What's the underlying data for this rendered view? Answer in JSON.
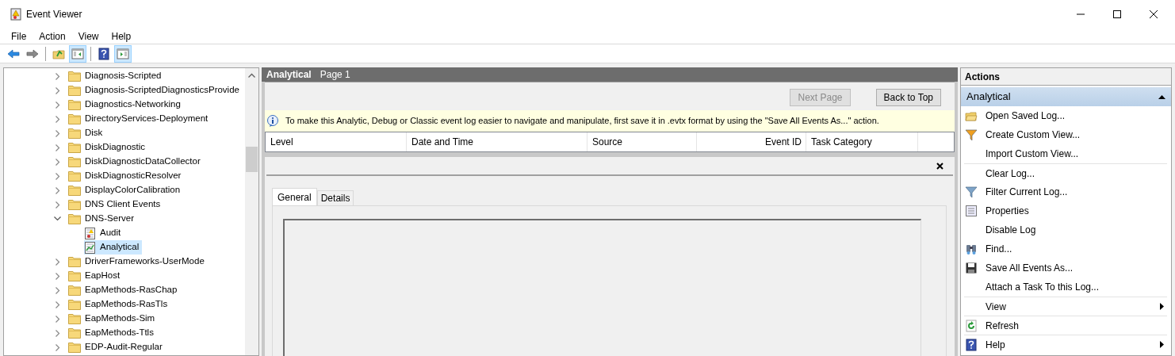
{
  "window": {
    "title": "Event Viewer"
  },
  "menu": [
    "File",
    "Action",
    "View",
    "Help"
  ],
  "toolbar": [
    {
      "pressed": false
    },
    {
      "pressed": false
    },
    {
      "pressed": false
    },
    {
      "pressed": true
    },
    {
      "pressed": false
    },
    {
      "pressed": true
    }
  ],
  "tree": [
    {
      "label": "Diagnosis-Scripted",
      "expanded": false
    },
    {
      "label": "Diagnosis-ScriptedDiagnosticsProvide",
      "expanded": false
    },
    {
      "label": "Diagnostics-Networking",
      "expanded": false
    },
    {
      "label": "DirectoryServices-Deployment",
      "expanded": false
    },
    {
      "label": "Disk",
      "expanded": false
    },
    {
      "label": "DiskDiagnostic",
      "expanded": false
    },
    {
      "label": "DiskDiagnosticDataCollector",
      "expanded": false
    },
    {
      "label": "DiskDiagnosticResolver",
      "expanded": false
    },
    {
      "label": "DisplayColorCalibration",
      "expanded": false
    },
    {
      "label": "DNS Client Events",
      "expanded": false
    },
    {
      "label": "DNS-Server",
      "expanded": true,
      "children": [
        {
          "label": "Audit",
          "selected": false
        },
        {
          "label": "Analytical",
          "selected": true
        }
      ]
    },
    {
      "label": "DriverFrameworks-UserMode",
      "expanded": false
    },
    {
      "label": "EapHost",
      "expanded": false
    },
    {
      "label": "EapMethods-RasChap",
      "expanded": false
    },
    {
      "label": "EapMethods-RasTls",
      "expanded": false
    },
    {
      "label": "EapMethods-Sim",
      "expanded": false
    },
    {
      "label": "EapMethods-Ttls",
      "expanded": false
    },
    {
      "label": "EDP-Audit-Regular",
      "expanded": false
    }
  ],
  "log_header": {
    "title": "Analytical",
    "page": "Page 1"
  },
  "paging": [
    {
      "label": "Next Page",
      "disabled": true
    },
    {
      "label": "Back to Top",
      "disabled": false
    }
  ],
  "info_bar": "To make this Analytic, Debug or Classic event log easier to navigate and manipulate, first save it in .evtx format by using the \"Save All Events As...\" action.",
  "table": {
    "columns": [
      "Level",
      "Date and Time",
      "Source",
      "Event ID",
      "Task Category"
    ]
  },
  "preview": {
    "tabs": [
      {
        "label": "General",
        "selected": true
      },
      {
        "label": "Details",
        "selected": false
      }
    ]
  },
  "actions": {
    "title": "Actions",
    "section": "Analytical",
    "items": [
      {
        "label": "Open Saved Log...",
        "separator_before": false,
        "submenu": false
      },
      {
        "label": "Create Custom View...",
        "separator_before": false,
        "submenu": false
      },
      {
        "label": "Import Custom View...",
        "separator_before": false,
        "submenu": false
      },
      {
        "label": "Clear Log...",
        "separator_before": true,
        "submenu": false
      },
      {
        "label": "Filter Current Log...",
        "separator_before": false,
        "submenu": false
      },
      {
        "label": "Properties",
        "separator_before": false,
        "submenu": false
      },
      {
        "label": "Disable Log",
        "separator_before": false,
        "submenu": false
      },
      {
        "label": "Find...",
        "separator_before": false,
        "submenu": false
      },
      {
        "label": "Save All Events As...",
        "separator_before": false,
        "submenu": false
      },
      {
        "label": "Attach a Task To this Log...",
        "separator_before": false,
        "submenu": false
      },
      {
        "label": "View",
        "separator_before": true,
        "submenu": true
      },
      {
        "label": "Refresh",
        "separator_before": true,
        "submenu": false
      },
      {
        "label": "Help",
        "separator_before": true,
        "submenu": true
      }
    ]
  }
}
